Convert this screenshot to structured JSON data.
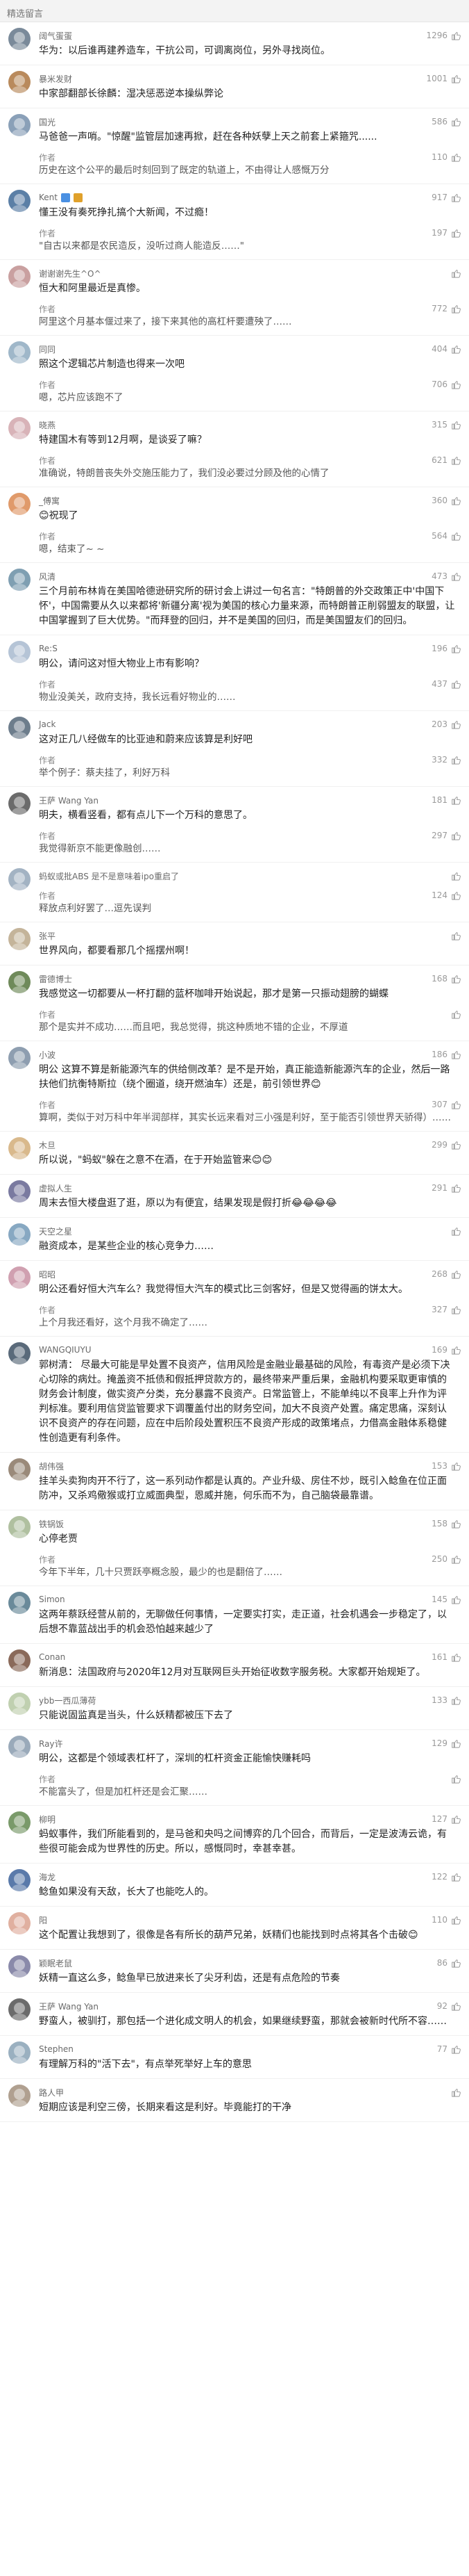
{
  "header": {
    "title": "精选留言"
  },
  "comments": [
    {
      "user": "阔气蛋蛋",
      "likes": "1296",
      "color": "#7a8a9a",
      "text": "华为：以后谁再建养造车，干抗公司，可调离岗位，另外寻找岗位。",
      "replies": []
    },
    {
      "user": "暴米发财",
      "likes": "1001",
      "color": "#b98a5c",
      "text": "中家部翻部长徐麟：湿决惩恶逆本操纵弊论",
      "replies": []
    },
    {
      "user": "国光",
      "likes": "586",
      "color": "#8aa0b8",
      "text": "马爸爸一声哨。\"惊醒\"监管层加速再掀，赶在各种妖孽上天之前套上紧箍咒......",
      "replies": [
        {
          "user": "作者",
          "likes": "110",
          "text": "历史在这个公平的最后时刻回到了既定的轨道上，不由得让人感慨万分"
        }
      ]
    },
    {
      "user": "Kent",
      "likes": "917",
      "color": "#5b7fa6",
      "badge": true,
      "text": "懂王没有奏死挣扎搞个大新闻，不过瘾！",
      "replies": [
        {
          "user": "作者",
          "likes": "197",
          "text": "\"自古以来都是农民造反，没听过商人能造反……\""
        }
      ]
    },
    {
      "user": "谢谢谢先生^O^",
      "likes": "",
      "color": "#c9a0a0",
      "text": "恒大和阿里最近是真惨。",
      "replies": [
        {
          "user": "作者",
          "likes": "772",
          "text": "阿里这个月基本偃过来了，接下来其他的高杠杆要遭殃了……"
        }
      ]
    },
    {
      "user": "同同",
      "likes": "404",
      "color": "#9fb7c9",
      "text": "照这个逻辑芯片制造也得来一次吧",
      "replies": [
        {
          "user": "作者",
          "likes": "706",
          "text": "嗯，芯片应该跑不了"
        }
      ]
    },
    {
      "user": "晓燕",
      "likes": "315",
      "color": "#d8b3b8",
      "text": "特建国木有等到12月啊，是谈妥了嘛？",
      "replies": [
        {
          "user": "作者",
          "likes": "621",
          "text": "准确说，特朗普丧失外交施压能力了，我们没必要过分顾及他的心情了"
        }
      ]
    },
    {
      "user": "_傅寓",
      "likes": "360",
      "color": "#e09a6a",
      "text": "😊祝现了",
      "replies": [
        {
          "user": "作者",
          "likes": "564",
          "text": "嗯，结束了~ ~"
        }
      ]
    },
    {
      "user": "风清",
      "likes": "473",
      "color": "#7f9fb2",
      "text": "三个月前布林肯在美国哈德逊研究所的研讨会上讲过一句名言：\"特朗普的外交政策正中'中国下怀'，中国需要从久以来都将'新疆分离'视为美国的核心力量来源，而特朗普正削弱盟友的联盟，让中国掌握到了巨大优势。\"而拜登的回归，并不是美国的回归，而是美国盟友们的回归。",
      "replies": []
    },
    {
      "user": "Re:S",
      "likes": "196",
      "color": "#b5c4d6",
      "text": "明公，请问这对恒大物业上市有影响？",
      "replies": [
        {
          "user": "作者",
          "likes": "437",
          "text": "物业没美关，政府支持，我长远看好物业的……"
        }
      ]
    },
    {
      "user": "Jack",
      "likes": "203",
      "color": "#6d7d8c",
      "text": "这对正几八经做车的比亚迪和蔚来应该算是利好吧",
      "replies": [
        {
          "user": "作者",
          "likes": "332",
          "text": "举个例子：蔡夫挂了，利好万科"
        }
      ]
    },
    {
      "user": "王萨 Wang Yan",
      "likes": "181",
      "color": "#6b6b6b",
      "text": "明夫，横看竖看，都有点儿下一个万科的意思了。",
      "replies": [
        {
          "user": "作者",
          "likes": "297",
          "text": "我觉得新京不能更像融创……"
        }
      ]
    },
    {
      "user": "蚂蚁或批ABS 是不是意味着ipo重启了",
      "likes": "",
      "color": "#a3b3c3",
      "text": "",
      "replies": [
        {
          "user": "作者",
          "likes": "124",
          "text": "释放点利好罢了…逗先误判"
        }
      ]
    },
    {
      "user": "张平",
      "likes": "",
      "color": "#c4b49a",
      "text": "世界风向，都要看那几个摇摆州啊！",
      "replies": []
    },
    {
      "user": "雷德博士",
      "likes": "168",
      "color": "#6f8a5a",
      "text": "我感觉这一切都要从一杯打翻的蓝杯咖啡开始说起，那才是第一只振动翅膀的蝴蝶",
      "replies": [
        {
          "user": "作者",
          "likes": "",
          "text": "那个是实并不成功……而且吧，我总觉得，挑这种质地不错的企业，不厚道"
        }
      ]
    },
    {
      "user": "小波",
      "likes": "186",
      "color": "#8e9eb0",
      "text": "明公 这算不算是新能源汽车的供给侧改革？是不是开始，真正能造新能源汽车的企业，然后一路扶他们抗衡特斯拉（绕个圈道，绕开燃油车）还是，前引领世界😊",
      "replies": [
        {
          "user": "作者",
          "likes": "307",
          "text": "算啊，类似于对万科中年半润部样，其实长远来看对三小强是利好，至于能否引领世界天骄得）……"
        }
      ]
    },
    {
      "user": "木旦",
      "likes": "299",
      "color": "#d9b98c",
      "text": "所以说，\"蚂蚁\"躲在之意不在酒，在于开始监管来😊😊",
      "replies": []
    },
    {
      "user": "虚拟人生",
      "likes": "291",
      "color": "#7a7aa0",
      "text": "周末去恒大楼盘逛了逛，原以为有便宜，结果发现是假打折😂😂😂😂",
      "replies": []
    },
    {
      "user": "天空之星",
      "likes": "",
      "color": "#87a8c2",
      "text": "融资成本，是某些企业的核心竞争力……",
      "replies": []
    },
    {
      "user": "昭昭",
      "likes": "268",
      "color": "#d0a0b0",
      "text": "明公还看好恒大汽车么？我觉得恒大汽车的模式比三剑客好，但是又觉得画的饼太大。",
      "replies": [
        {
          "user": "作者",
          "likes": "327",
          "text": "上个月我还看好，这个月我不确定了……"
        }
      ]
    },
    {
      "user": "WANGQIUYU",
      "likes": "169",
      "color": "#5a6a7a",
      "text": "郭树清： 尽最大可能是早处置不良资产，信用风险是金融业最基础的风险，有毒资产是必须下决心切除的病灶。掩盖资不抵债和假抵押贷款方的，最终带来严重后果，金融机构要采取更审慎的财务会计制度，做实资产分类，充分暴露不良资产。日常监管上，不能单纯以不良率上升作为评判标准。要利用信贷监管要求下调覆盖付出的财务空间，加大不良资产处置。痛定思痛，深刻认识不良资产的存在问题，应在中后阶段处置积压不良资产形成的政策堵点，力借高金融体系稳健性创造更有利条件。",
      "replies": []
    },
    {
      "user": "胡伟强",
      "likes": "153",
      "color": "#9a8a7a",
      "text": "挂羊头卖狗肉开不行了，这一系列动作都是认真的。产业升级、房住不炒，既引入鲶鱼在位正面防冲，又杀鸡儆猴或打立威面典型，恩威并施，何乐而不为，自己脑袋最靠谱。",
      "replies": []
    },
    {
      "user": "铁锅饭",
      "likes": "158",
      "color": "#b0c0a0",
      "text": "心停老贾",
      "replies": [
        {
          "user": "作者",
          "likes": "250",
          "text": "今年下半年，几十只贾跃亭概念股，最少的也是翻倍了……"
        }
      ]
    },
    {
      "user": "Simon",
      "likes": "145",
      "color": "#6a8a9a",
      "text": "这两年蔡跃经营从前的，无聊做任何事情，一定要实打实，走正道，社会机遇会一步稳定了，以后想不靠蓝战出手的机会恐怕越来越少了",
      "replies": []
    },
    {
      "user": "Conan",
      "likes": "161",
      "color": "#8a6a5a",
      "text": "新消息：法国政府与2020年12月对互联网巨头开始征收数字服务税。大家都开始规矩了。",
      "replies": []
    },
    {
      "user": "ybb一西瓜薄荷",
      "likes": "133",
      "color": "#c0d0b0",
      "text": "只能说固监真是当头，什么妖精都被压下去了",
      "replies": []
    },
    {
      "user": "Ray许",
      "likes": "129",
      "color": "#9aaaba",
      "text": "明公，这都是个领域表杠杆了，深圳的杠杆资金正能愉快赚耗吗",
      "replies": [
        {
          "user": "作者",
          "likes": "",
          "text": "不能富头了，但是加杠杆还是会汇聚……"
        }
      ]
    },
    {
      "user": "柳明",
      "likes": "127",
      "color": "#7a9a6a",
      "text": "蚂蚁事件，我们所能看到的，是马爸和央吗之间博弈的几个回合，而背后，一定是波涛云诡，有些很可能会成为世界性的历史。所以，感慨同时，幸甚幸甚。",
      "replies": []
    },
    {
      "user": "海龙",
      "likes": "122",
      "color": "#5a7aaa",
      "text": "鲶鱼如果没有天敌，长大了也能吃人的。",
      "replies": []
    },
    {
      "user": "阳",
      "likes": "110",
      "color": "#e0b0a0",
      "text": "这个配置让我想到了，很像是各有所长的葫芦兄弟，妖精们也能找到时点将其各个击破😊",
      "replies": []
    },
    {
      "user": "颖眠老鼠",
      "likes": "86",
      "color": "#8a8aaa",
      "text": "妖精一直这么多，鲶鱼早已放进来长了尖牙利齿，还是有点危险的节奏",
      "replies": []
    },
    {
      "user": "王萨 Wang Yan",
      "likes": "92",
      "color": "#6b6b6b",
      "text": "野蛮人，被驯打，那包括一个进化成文明人的机会，如果继续野蛮，那就会被新时代所不容……",
      "replies": []
    },
    {
      "user": "Stephen",
      "likes": "77",
      "color": "#9ab0c0",
      "text": "有理解万科的\"活下去\"，有点举死举好上车的意思",
      "replies": []
    },
    {
      "user": "路人甲",
      "likes": "",
      "color": "#b0a090",
      "text": "短期应该是利空三傍，长期来看这是利好。毕竟能打的干净",
      "replies": []
    }
  ]
}
